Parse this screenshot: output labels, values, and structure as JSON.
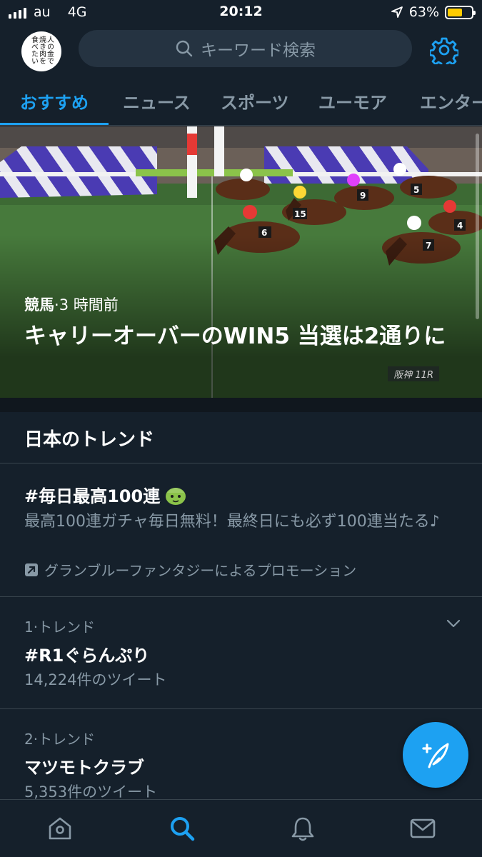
{
  "status_bar": {
    "carrier": "au",
    "network": "4G",
    "time": "20:12",
    "battery": "63%",
    "battery_level": 0.63
  },
  "header": {
    "avatar_text": "人の金で焼き肉を食べたい",
    "search_placeholder": "キーワード検索",
    "settings_icon": "gear-icon"
  },
  "tabs": [
    {
      "label": "おすすめ",
      "active": true
    },
    {
      "label": "ニュース",
      "active": false
    },
    {
      "label": "スポーツ",
      "active": false
    },
    {
      "label": "ユーモア",
      "active": false
    },
    {
      "label": "エンター",
      "active": false
    }
  ],
  "hero": {
    "category": "競馬",
    "time": "3 時間前",
    "title": "キャリーオーバーのWIN5 当選は2通りに",
    "caption": "阪神 11R"
  },
  "trends": {
    "heading": "日本のトレンド",
    "promo": {
      "title": "#毎日最高100連",
      "description": "最高100連ガチャ毎日無料！最終日にも必ず100連当たる♪",
      "promoted_by": "グランブルーファンタジーによるプロモーション"
    },
    "items": [
      {
        "rank": "1·トレンド",
        "name": "#R1ぐらんぷり",
        "count": "14,224件のツイート"
      },
      {
        "rank": "2·トレンド",
        "name": "マツモトクラブ",
        "count": "5,353件のツイート"
      }
    ]
  },
  "bottom_nav": [
    "home-icon",
    "search-icon",
    "notifications-icon",
    "messages-icon"
  ],
  "colors": {
    "background": "#15202b",
    "accent": "#1da1f2",
    "secondary_text": "#8899a6",
    "divider": "#38444d"
  }
}
